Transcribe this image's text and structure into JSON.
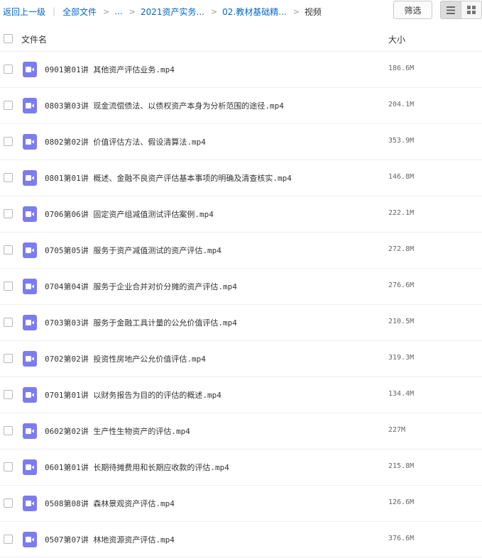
{
  "breadcrumb": {
    "back": "返回上一级",
    "separator": "|",
    "root": "全部文件",
    "arrow": ">",
    "ellipsis": "...",
    "level1": "2021资产实务...",
    "level2": "02.教材基础精...",
    "current": "视频"
  },
  "toolbar": {
    "filter_label": "筛选",
    "view_mode": "list"
  },
  "columns": {
    "name": "文件名",
    "size": "大小"
  },
  "files": [
    {
      "name": "0901第01讲  其他资产评估业务.mp4",
      "size": "186.6M"
    },
    {
      "name": "0803第03讲  现金流偿债法、以债权资产本身为分析范围的途径.mp4",
      "size": "204.1M"
    },
    {
      "name": "0802第02讲  价值评估方法、假设清算法.mp4",
      "size": "353.9M"
    },
    {
      "name": "0801第01讲  概述、金融不良资产评估基本事项的明确及清查核实.mp4",
      "size": "146.8M"
    },
    {
      "name": "0706第06讲  固定资产组减值测试评估案例.mp4",
      "size": "222.1M"
    },
    {
      "name": "0705第05讲  服务于资产减值测试的资产评估.mp4",
      "size": "272.8M"
    },
    {
      "name": "0704第04讲  服务于企业合并对价分摊的资产评估.mp4",
      "size": "276.6M"
    },
    {
      "name": "0703第03讲  服务于金融工具计量的公允价值评估.mp4",
      "size": "210.5M"
    },
    {
      "name": "0702第02讲  投资性房地产公允价值评估.mp4",
      "size": "319.3M"
    },
    {
      "name": "0701第01讲  以财务报告为目的的评估的概述.mp4",
      "size": "134.4M"
    },
    {
      "name": "0602第02讲  生产性生物资产的评估.mp4",
      "size": "227M"
    },
    {
      "name": "0601第01讲  长期待摊费用和长期应收款的评估.mp4",
      "size": "215.8M"
    },
    {
      "name": "0508第08讲  森林景观资产评估.mp4",
      "size": "126.6M"
    },
    {
      "name": "0507第07讲  林地资源资产评估.mp4",
      "size": "376.6M"
    }
  ],
  "icons": {
    "file_type": "video-file-icon",
    "list_view": "list-view-icon",
    "grid_view": "grid-view-icon"
  },
  "colors": {
    "link": "#0066cc",
    "video_icon": "#7b7cf0"
  }
}
